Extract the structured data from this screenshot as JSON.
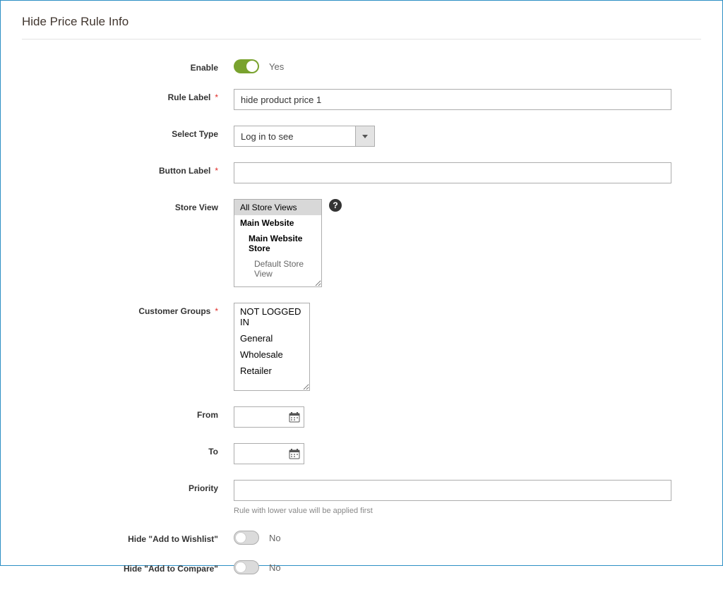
{
  "section_title": "Hide Price Rule Info",
  "fields": {
    "enable": {
      "label": "Enable",
      "on": true,
      "value_text": "Yes"
    },
    "rule_label": {
      "label": "Rule Label",
      "value": "hide product price 1"
    },
    "select_type": {
      "label": "Select Type",
      "value": "Log in to see"
    },
    "button_label": {
      "label": "Button Label",
      "value": ""
    },
    "store_view": {
      "label": "Store View",
      "all": "All Store Views",
      "website": "Main Website",
      "store": "Main Website Store",
      "view": "Default Store View"
    },
    "customer_groups": {
      "label": "Customer Groups",
      "options": [
        "NOT LOGGED IN",
        "General",
        "Wholesale",
        "Retailer"
      ]
    },
    "from": {
      "label": "From",
      "value": ""
    },
    "to": {
      "label": "To",
      "value": ""
    },
    "priority": {
      "label": "Priority",
      "value": "",
      "hint": "Rule with lower value will be applied first"
    },
    "hide_wishlist": {
      "label": "Hide \"Add to Wishlist\"",
      "on": false,
      "value_text": "No"
    },
    "hide_compare": {
      "label": "Hide \"Add to Compare\"",
      "on": false,
      "value_text": "No"
    }
  }
}
